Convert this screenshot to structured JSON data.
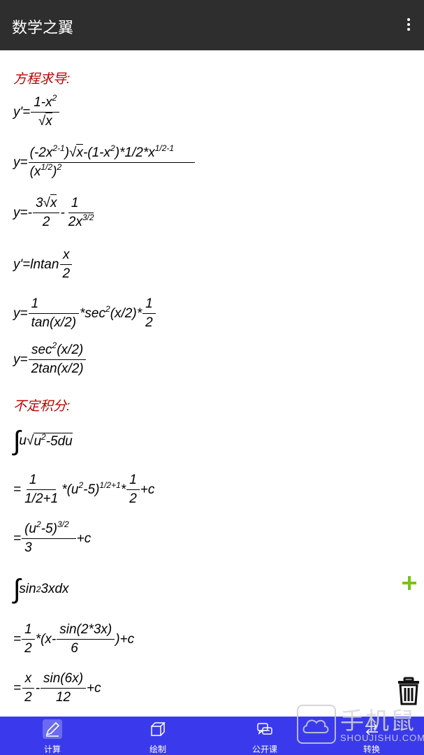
{
  "app": {
    "title": "数学之翼"
  },
  "sections": {
    "derivative": "方程求导:",
    "integral": "不定积分:"
  },
  "derivative": {
    "e1": {
      "lhs": "y'=",
      "num_base": "1-x",
      "num_exp": "2",
      "den": "x"
    },
    "e2": {
      "lhs": "y=",
      "num": [
        "(-2x",
        "2-1",
        ")",
        "x",
        "-(1-x",
        "2",
        ")*1/2*x",
        "1/2-1"
      ],
      "den": [
        "(x",
        "1/2",
        ")",
        "2"
      ]
    },
    "e3": {
      "lhs": "y=-",
      "f1_num": [
        "3",
        "x"
      ],
      "f1_den": "2",
      "mid": "-",
      "f2_num": "1",
      "f2_den": [
        "2x",
        "3/2"
      ]
    },
    "e4": {
      "lhs": "y'=lntan",
      "num": "x",
      "den": "2"
    },
    "e5": {
      "lhs": "y=",
      "f1_num": "1",
      "f1_den": "tan(x/2)",
      "mid_a": "*sec",
      "mid_exp": "2",
      "mid_b": "(x/2)*",
      "f2_num": "1",
      "f2_den": "2"
    },
    "e6": {
      "lhs": "y=",
      "num_a": "sec",
      "num_exp": "2",
      "num_b": "(x/2)",
      "den": "2tan(x/2)"
    }
  },
  "integral": {
    "i1": {
      "a": "u",
      "b": "u",
      "exp": "2",
      "c": "-5du"
    },
    "i2": {
      "lhs": "=",
      "f1_num": "1",
      "f1_den": "1/2+1",
      "mid_a": "*(u",
      "mid_exp1": "2",
      "mid_b": "-5)",
      "mid_exp2": "1/2+1",
      "mid_c": "*",
      "f2_num": "1",
      "f2_den": "2",
      "tail": "+c"
    },
    "i3": {
      "lhs": "=",
      "num_a": "(u",
      "num_exp1": "2",
      "num_b": "-5)",
      "num_exp2": "3/2",
      "den": "3",
      "tail": "+c"
    },
    "i4": {
      "a": "sin",
      "exp": "2",
      "b": "3xdx"
    },
    "i5": {
      "lhs": "=",
      "f1_num": "1",
      "f1_den": "2",
      "mid": "*(x-",
      "f2_num": "sin(2*3x)",
      "f2_den": "6",
      "tail": ")+c"
    },
    "i6": {
      "lhs": "=",
      "f1_num": "x",
      "f1_den": "2",
      "mid": "-",
      "f2_num": "sin(6x)",
      "f2_den": "12",
      "tail": "+c"
    }
  },
  "nav": {
    "items": [
      {
        "label": "计算"
      },
      {
        "label": "绘制"
      },
      {
        "label": "公开课"
      },
      {
        "label": "转换"
      }
    ]
  },
  "watermark": {
    "cn": "手机鼠",
    "en": "SHOUJISHU.COM"
  },
  "colors": {
    "appbar": "#2e2e2e",
    "section": "#bb0000",
    "plus": "#7cc21a",
    "navbar": "#3a3aec"
  }
}
